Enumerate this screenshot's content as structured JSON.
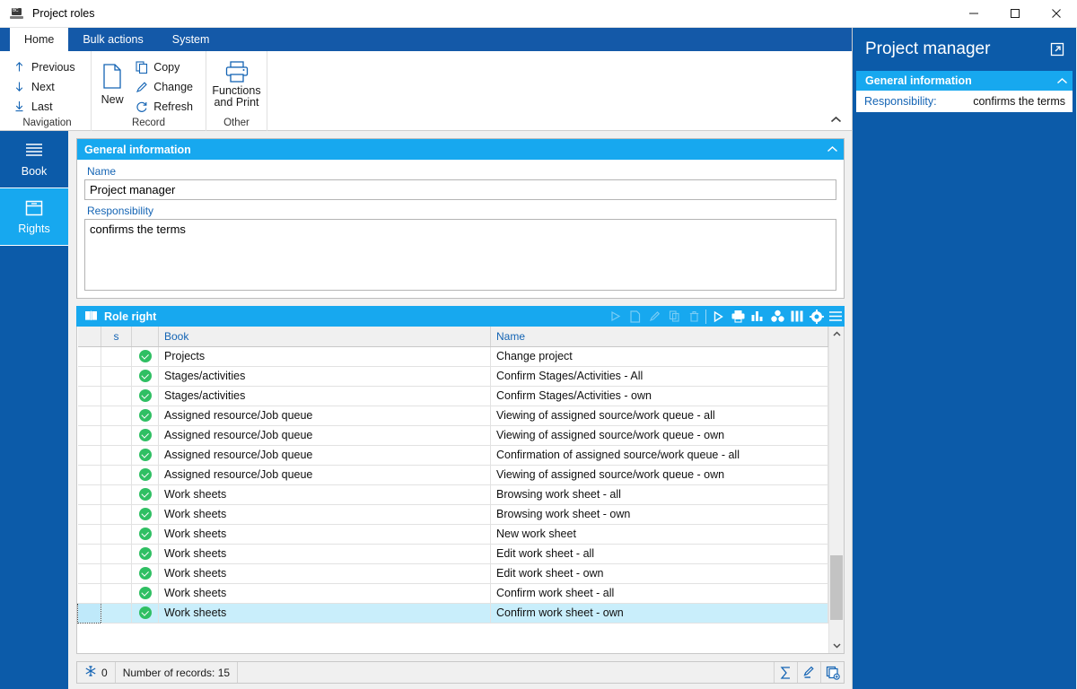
{
  "window": {
    "title": "Project roles",
    "icon": "app-icon",
    "controls": {
      "minimize": "minimize-icon",
      "maximize": "maximize-icon",
      "close": "close-icon"
    }
  },
  "ribbon": {
    "tabs": [
      {
        "label": "Home",
        "active": true
      },
      {
        "label": "Bulk actions",
        "active": false
      },
      {
        "label": "System",
        "active": false
      }
    ],
    "groups": [
      {
        "label": "Navigation",
        "small_buttons": [
          {
            "label": "Previous",
            "icon": "arrow-up-icon"
          },
          {
            "label": "Next",
            "icon": "arrow-down-icon"
          },
          {
            "label": "Last",
            "icon": "arrow-down-to-line-icon"
          }
        ]
      },
      {
        "label": "Record",
        "big_buttons": [
          {
            "label": "New",
            "icon": "new-document-icon"
          }
        ],
        "small_buttons": [
          {
            "label": "Copy",
            "icon": "copy-icon"
          },
          {
            "label": "Change",
            "icon": "pencil-icon"
          },
          {
            "label": "Refresh",
            "icon": "refresh-icon"
          }
        ]
      },
      {
        "label": "Other",
        "big_buttons": [
          {
            "label": "Functions and Print",
            "label_line1": "Functions",
            "label_line2": "and Print",
            "icon": "printer-icon"
          }
        ]
      }
    ],
    "collapse_icon": "chevron-up-icon"
  },
  "nav_strip": {
    "items": [
      {
        "label": "Book",
        "icon": "book-list-icon",
        "selected": false
      },
      {
        "label": "Rights",
        "icon": "rights-box-icon",
        "selected": true
      }
    ]
  },
  "general_information": {
    "title": "General information",
    "collapse_icon": "chevron-up-icon",
    "fields": [
      {
        "label": "Name",
        "value": "Project manager",
        "type": "text"
      },
      {
        "label": "Responsibility",
        "value": "confirms the terms",
        "type": "textarea"
      }
    ]
  },
  "role_right": {
    "title": "Role right",
    "title_icon": "book-open-icon",
    "toolbar_dim": [
      {
        "icon": "play-icon"
      },
      {
        "icon": "new-document-icon"
      },
      {
        "icon": "pencil-icon"
      },
      {
        "icon": "copy-icon"
      },
      {
        "icon": "trash-icon"
      }
    ],
    "toolbar": [
      {
        "icon": "play-icon"
      },
      {
        "icon": "printer-icon"
      },
      {
        "icon": "bar-chart-icon"
      },
      {
        "icon": "pivot-icon"
      },
      {
        "icon": "columns-icon"
      },
      {
        "icon": "gear-icon"
      },
      {
        "icon": "hamburger-menu-icon"
      }
    ],
    "columns": [
      "",
      "s",
      "",
      "Book",
      "Name"
    ],
    "rows": [
      {
        "checked": true,
        "book": "Projects",
        "name": "Change project",
        "selected": false
      },
      {
        "checked": true,
        "book": "Stages/activities",
        "name": "Confirm Stages/Activities - All",
        "selected": false
      },
      {
        "checked": true,
        "book": "Stages/activities",
        "name": "Confirm Stages/Activities - own",
        "selected": false
      },
      {
        "checked": true,
        "book": "Assigned resource/Job queue",
        "name": "Viewing of assigned source/work queue - all",
        "selected": false
      },
      {
        "checked": true,
        "book": "Assigned resource/Job queue",
        "name": "Viewing of assigned source/work queue - own",
        "selected": false
      },
      {
        "checked": true,
        "book": "Assigned resource/Job queue",
        "name": "Confirmation of assigned source/work queue - all",
        "selected": false
      },
      {
        "checked": true,
        "book": "Assigned resource/Job queue",
        "name": "Viewing of assigned source/work queue - own",
        "selected": false
      },
      {
        "checked": true,
        "book": "Work sheets",
        "name": "Browsing work sheet - all",
        "selected": false
      },
      {
        "checked": true,
        "book": "Work sheets",
        "name": "Browsing work sheet - own",
        "selected": false
      },
      {
        "checked": true,
        "book": "Work sheets",
        "name": "New work sheet",
        "selected": false
      },
      {
        "checked": true,
        "book": "Work sheets",
        "name": "Edit work sheet - all",
        "selected": false
      },
      {
        "checked": true,
        "book": "Work sheets",
        "name": "Edit work sheet - own",
        "selected": false
      },
      {
        "checked": true,
        "book": "Work sheets",
        "name": "Confirm work sheet - all",
        "selected": false
      },
      {
        "checked": true,
        "book": "Work sheets",
        "name": "Confirm work sheet - own",
        "selected": true
      }
    ]
  },
  "status_bar": {
    "filter_icon": "snowflake-filter-icon",
    "filter_count": "0",
    "records_label": "Number of records: 15",
    "right_icons": [
      {
        "icon": "sum-sigma-icon"
      },
      {
        "icon": "pencil-edit-icon"
      },
      {
        "icon": "add-record-icon"
      }
    ]
  },
  "side_panel": {
    "title": "Project manager",
    "popout_icon": "popout-icon",
    "section": {
      "title": "General information",
      "collapse_icon": "chevron-up-icon",
      "rows": [
        {
          "key": "Responsibility:",
          "value": "confirms the terms"
        }
      ]
    }
  },
  "colors": {
    "titlebar_bg": "#ffffff",
    "ribbon_tab_bg": "#1459a8",
    "accent_cyan": "#17a8ef",
    "accent_blue": "#0c5ba9",
    "link_blue": "#1464b4",
    "check_green": "#2fbf63",
    "selected_row": "#c9eefb"
  }
}
